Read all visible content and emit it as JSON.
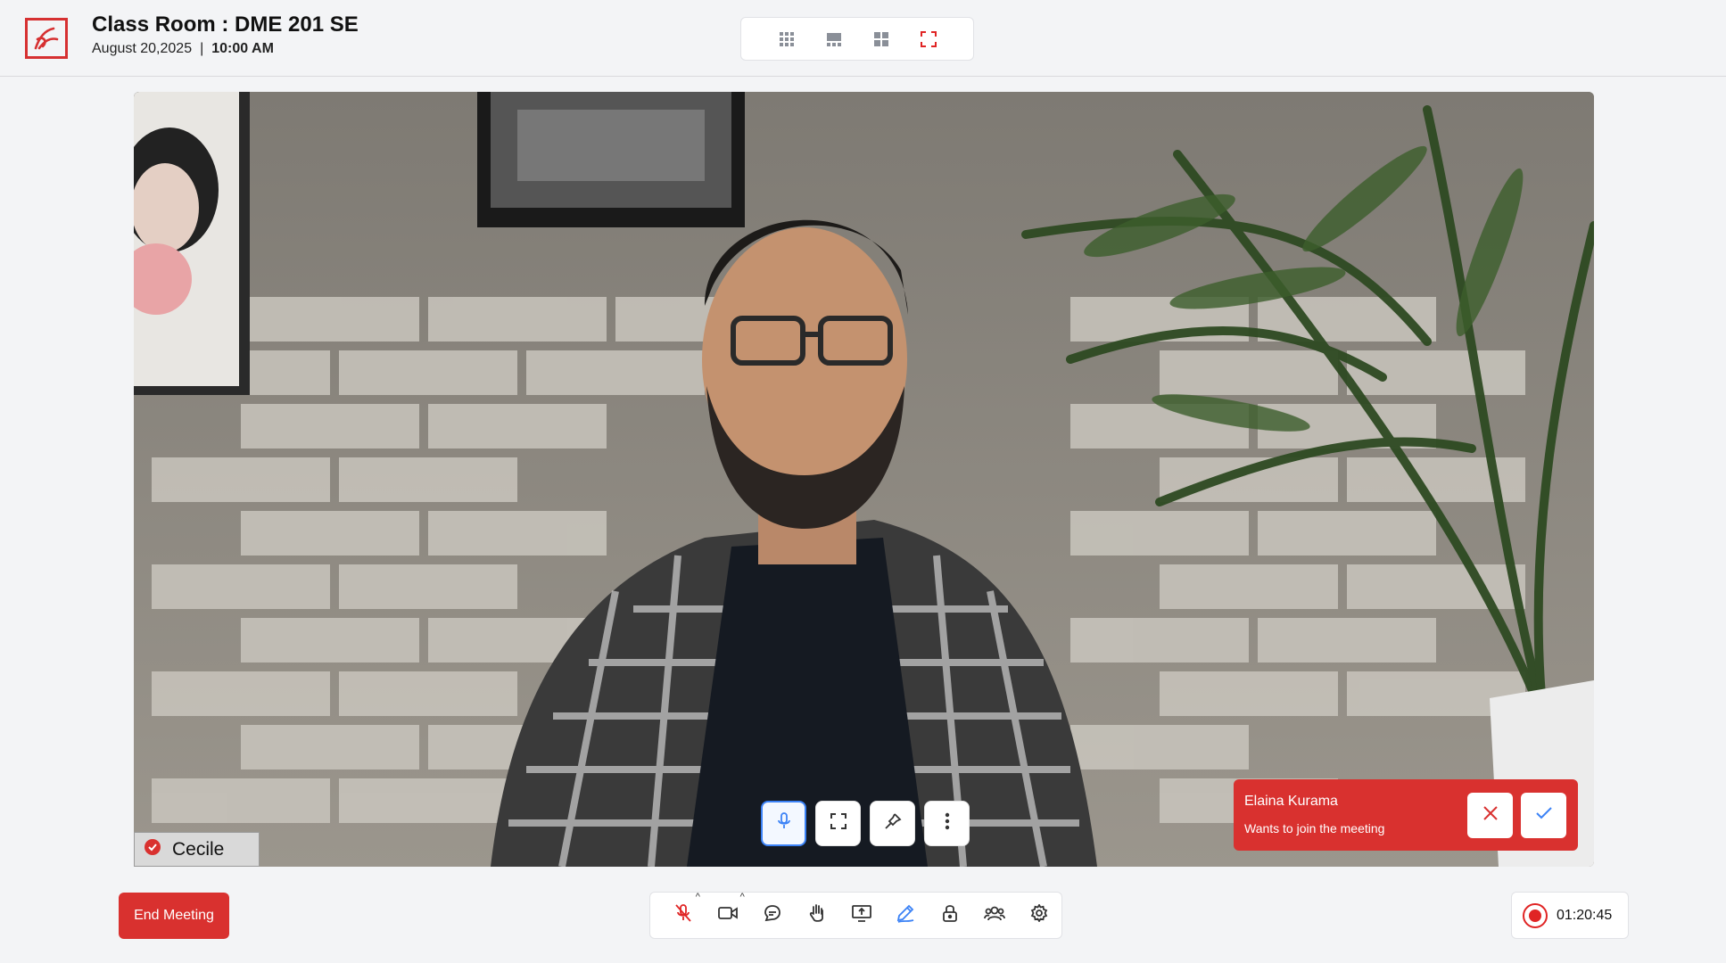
{
  "header": {
    "title": "Class Room : DME 201 SE",
    "date": "August 20,2025",
    "separator": "|",
    "time": "10:00 AM",
    "logo_icon": "brand-logo",
    "brand_color": "#d63031"
  },
  "layout_switcher": {
    "buttons": [
      {
        "icon": "grid-9-icon"
      },
      {
        "icon": "speaker-view-icon"
      },
      {
        "icon": "grid-4-icon"
      },
      {
        "icon": "fullscreen-icon",
        "active": true
      }
    ]
  },
  "video": {
    "participant_name": "Cecile",
    "badge_icon": "verified-badge-icon",
    "tile_controls": [
      "mic-icon",
      "fullscreen-icon",
      "pin-icon",
      "more-vertical-icon"
    ]
  },
  "join_request": {
    "name": "Elaina Kurama",
    "message": "Wants to join the meeting",
    "reject_icon": "close-icon",
    "accept_icon": "check-icon"
  },
  "footer": {
    "end_meeting_label": "End Meeting",
    "toolbar_icons": [
      "mic-off-icon",
      "camera-icon",
      "chat-icon",
      "raise-hand-icon",
      "share-screen-icon",
      "whiteboard-pen-icon",
      "lock-icon",
      "participants-icon",
      "settings-icon"
    ],
    "recording_time": "01:20:45",
    "accent_red": "#d9312f",
    "accent_blue": "#3b82f6"
  }
}
